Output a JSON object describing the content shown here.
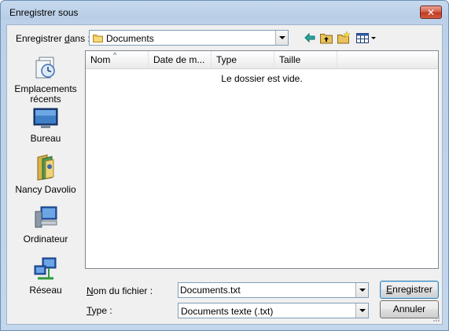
{
  "window": {
    "title": "Enregistrer sous",
    "close_label": "✕"
  },
  "toolbar": {
    "save_in_label_prefix": "Enregistrer ",
    "save_in_label_underlined": "d",
    "save_in_label_suffix": "ans :",
    "location_value": "Documents",
    "tools": [
      "back-icon",
      "up-folder-icon",
      "new-folder-icon",
      "view-menu-icon"
    ]
  },
  "places": [
    {
      "label": "Emplacements récents",
      "icon": "recent-places-icon"
    },
    {
      "label": "Bureau",
      "icon": "desktop-icon"
    },
    {
      "label": "Nancy Davolio",
      "icon": "user-folder-icon"
    },
    {
      "label": "Ordinateur",
      "icon": "computer-icon"
    },
    {
      "label": "Réseau",
      "icon": "network-icon"
    }
  ],
  "filelist": {
    "columns": [
      "Nom",
      "Date de m...",
      "Type",
      "Taille"
    ],
    "empty_message": "Le dossier est vide."
  },
  "form": {
    "filename_label_underlined": "N",
    "filename_label_rest": "om du fichier :",
    "filename_value": "Documents.txt",
    "type_label_underlined": "T",
    "type_label_rest": "ype :",
    "type_value": "Documents texte (.txt)",
    "save_button_underlined": "E",
    "save_button_rest": "nregistrer",
    "cancel_button": "Annuler"
  },
  "colors": {
    "titlebar": "#bcd1e9",
    "client_bg": "#f0f0f0",
    "close_button": "#c23a23",
    "field_border": "#7f9db9"
  }
}
